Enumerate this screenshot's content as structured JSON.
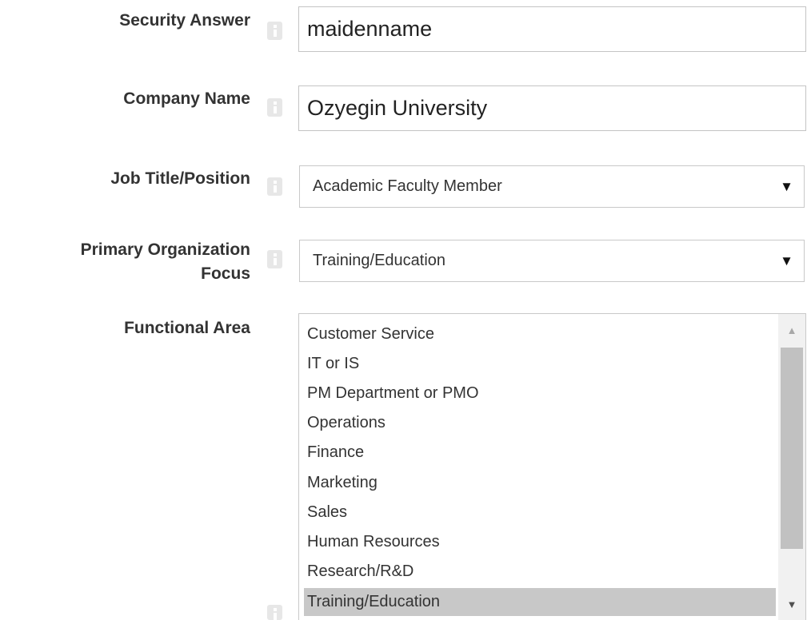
{
  "form": {
    "security_answer": {
      "label": "Security Answer",
      "value": "maidenname"
    },
    "company_name": {
      "label": "Company Name",
      "value": "Ozyegin University"
    },
    "job_title": {
      "label": "Job Title/Position",
      "selected": "Academic Faculty Member",
      "arrow": "▼"
    },
    "primary_focus": {
      "label_line1": "Primary Organization",
      "label_line2": "Focus",
      "selected": "Training/Education",
      "arrow": "▼"
    },
    "functional_area": {
      "label": "Functional Area",
      "options": [
        "Customer Service",
        "IT or IS",
        "PM Department or PMO",
        "Operations",
        "Finance",
        "Marketing",
        "Sales",
        "Human Resources",
        "Research/R&D",
        "Training/Education"
      ],
      "selected": "Training/Education",
      "scroll_up": "▲",
      "scroll_down": "▼"
    }
  },
  "icons": {
    "info": "info-icon"
  },
  "colors": {
    "label_text": "#333333",
    "input_border": "#c4c4c4",
    "info_icon": "#e7e7e7",
    "selected_option_bg": "#c8c8c8",
    "scrollbar_thumb": "#c1c1c1"
  }
}
